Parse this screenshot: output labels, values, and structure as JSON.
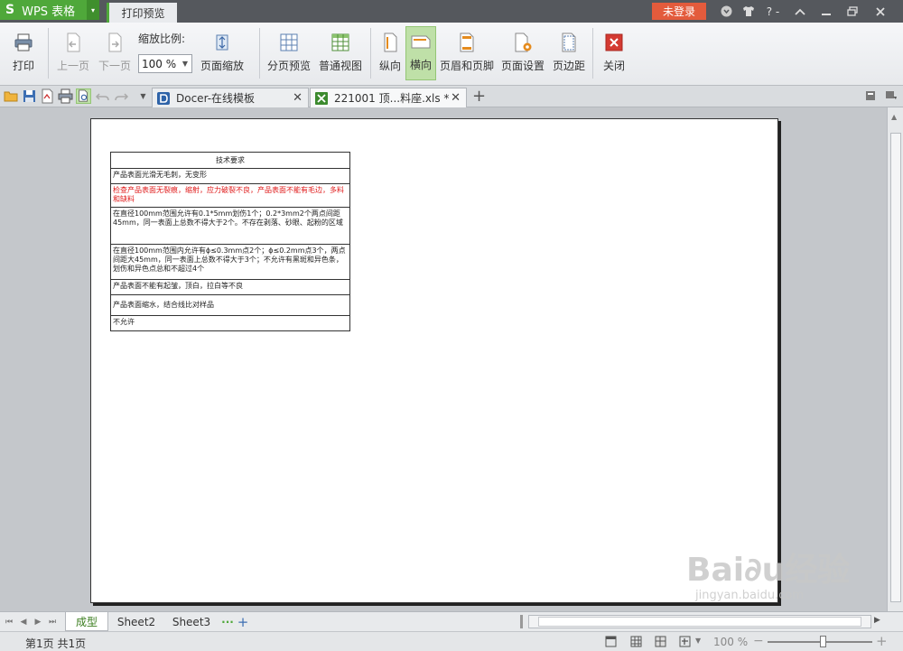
{
  "titlebar": {
    "app_logo": "S",
    "app_name": "WPS 表格",
    "app_menu_arrow": "▾",
    "active_tab": "打印预览",
    "login": "未登录",
    "help": "? -"
  },
  "ribbon": {
    "print": "打印",
    "prev_page": "上一页",
    "next_page": "下一页",
    "zoom_label": "缩放比例:",
    "zoom_value": "100 %",
    "page_zoom": "页面缩放",
    "page_break_preview": "分页预览",
    "normal_view": "普通视图",
    "portrait": "纵向",
    "landscape": "横向",
    "header_footer": "页眉和页脚",
    "page_setup": "页面设置",
    "margins": "页边距",
    "close": "关闭"
  },
  "doc_tabs": [
    {
      "label": "Docer-在线模板"
    },
    {
      "label": "221001 顶...料座.xls *"
    }
  ],
  "table": {
    "title": "技术要求",
    "rows": [
      "产品表面光滑无毛刺，无变形",
      "检查产品表面无裂痕，缩射，应力破裂不良，产品表面不能有毛边，多料和缺料",
      "在直径100mm范围允许有0.1*5mm划伤1个；0.2*3mm2个两点间距45mm，同一表面上总数不得大于2个。不存在剥落、砂眼、起粉的区域",
      "在直径100mm范围内允许有ɸ≤0.3mm点2个；ɸ≤0.2mm点3个，两点间距大45mm，同一表面上总数不得大于3个；不允许有黑斑和异色条，划伤和异色点总和不超过4个",
      "产品表面不能有起皱，顶白，拉白等不良",
      "产品表面缩水，结合线比对样品",
      "不允许"
    ]
  },
  "sheets": [
    {
      "label": "成型"
    },
    {
      "label": "Sheet2"
    },
    {
      "label": "Sheet3"
    }
  ],
  "sheet_more": "···",
  "sheet_add": "+",
  "status": {
    "page_info": "第1页 共1页",
    "zoom": "100 %"
  },
  "watermark": {
    "brand": "Bai∂u经验",
    "url": "jingyan.baidu.com"
  },
  "colors": {
    "accent_green": "#4fa83a",
    "login_red": "#e35b3c",
    "table_red_text": "#e01a1a"
  }
}
